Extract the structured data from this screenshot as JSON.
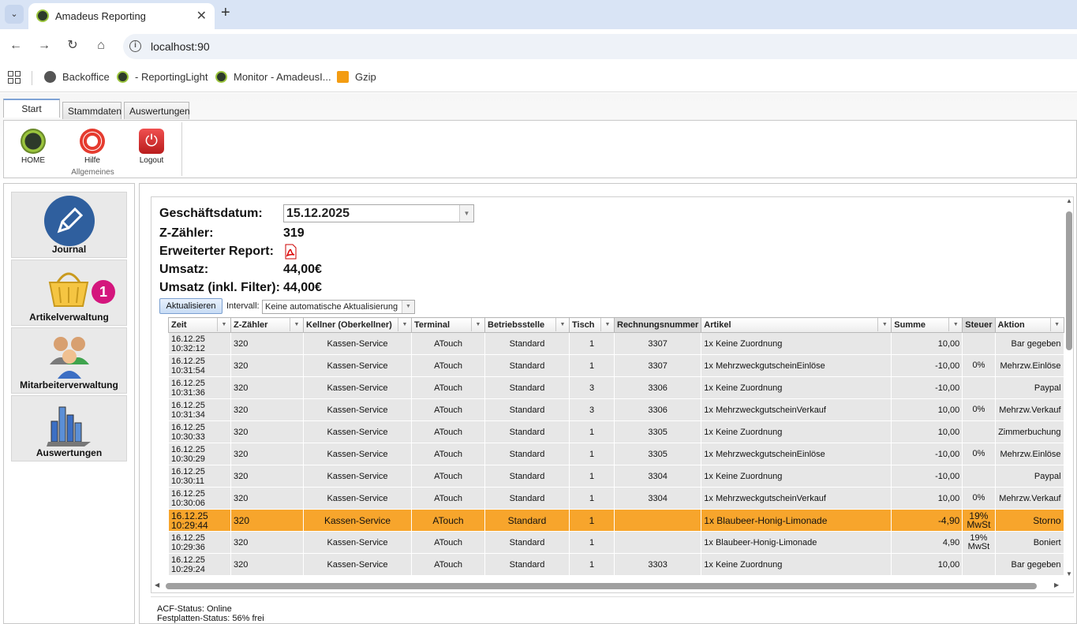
{
  "browser": {
    "tab_title": "Amadeus Reporting",
    "url": "localhost:90",
    "bookmarks": [
      "Backoffice",
      "- ReportingLight",
      "Monitor - AmadeusI...",
      "Gzip"
    ]
  },
  "ribbon": {
    "tabs": [
      "Start",
      "Stammdaten",
      "Auswertungen"
    ],
    "buttons": [
      "HOME",
      "Hilfe",
      "Logout"
    ],
    "group_label": "Allgemeines"
  },
  "nav": {
    "items": [
      "Journal",
      "Artikelverwaltung",
      "Mitarbeiterverwaltung",
      "Auswertungen"
    ],
    "badge": "1"
  },
  "report": {
    "labels": {
      "date": "Geschäftsdatum:",
      "z": "Z-Zähler:",
      "extended": "Erweiterter Report:",
      "umsatz": "Umsatz:",
      "umsatz_filter": "Umsatz (inkl. Filter):"
    },
    "date_value": "15.12.2025",
    "z_value": "319",
    "umsatz_value": "44,00€",
    "umsatz_filter_value": "44,00€",
    "refresh_label": "Aktualisieren",
    "intervall_label": "Intervall:",
    "intervall_value": "Keine automatische Aktualisierung"
  },
  "grid": {
    "columns": [
      "Zeit",
      "Z-Zähler",
      "Kellner (Oberkellner)",
      "Terminal",
      "Betriebsstelle",
      "Tisch",
      "Rechnungsnummer",
      "Artikel",
      "Summe",
      "Steuer",
      "Aktion"
    ],
    "rows": [
      {
        "d": "16.12.25",
        "t": "10:32:12",
        "z": "320",
        "k": "Kassen-Service",
        "term": "ATouch",
        "b": "Standard",
        "tisch": "1",
        "rn": "3307",
        "a": "1x Keine Zuordnung",
        "s": "10,00",
        "st": "",
        "ak": "Bar gegeben"
      },
      {
        "d": "16.12.25",
        "t": "10:31:54",
        "z": "320",
        "k": "Kassen-Service",
        "term": "ATouch",
        "b": "Standard",
        "tisch": "1",
        "rn": "3307",
        "a": "1x MehrzweckgutscheinEinlöse",
        "s": "-10,00",
        "st": "0%",
        "ak": "Mehrzw.Einlöse"
      },
      {
        "d": "16.12.25",
        "t": "10:31:36",
        "z": "320",
        "k": "Kassen-Service",
        "term": "ATouch",
        "b": "Standard",
        "tisch": "3",
        "rn": "3306",
        "a": "1x Keine Zuordnung",
        "s": "-10,00",
        "st": "",
        "ak": "Paypal"
      },
      {
        "d": "16.12.25",
        "t": "10:31:34",
        "z": "320",
        "k": "Kassen-Service",
        "term": "ATouch",
        "b": "Standard",
        "tisch": "3",
        "rn": "3306",
        "a": "1x MehrzweckgutscheinVerkauf",
        "s": "10,00",
        "st": "0%",
        "ak": "Mehrzw.Verkauf"
      },
      {
        "d": "16.12.25",
        "t": "10:30:33",
        "z": "320",
        "k": "Kassen-Service",
        "term": "ATouch",
        "b": "Standard",
        "tisch": "1",
        "rn": "3305",
        "a": "1x Keine Zuordnung",
        "s": "10,00",
        "st": "",
        "ak": "Zimmerbuchung"
      },
      {
        "d": "16.12.25",
        "t": "10:30:29",
        "z": "320",
        "k": "Kassen-Service",
        "term": "ATouch",
        "b": "Standard",
        "tisch": "1",
        "rn": "3305",
        "a": "1x MehrzweckgutscheinEinlöse",
        "s": "-10,00",
        "st": "0%",
        "ak": "Mehrzw.Einlöse"
      },
      {
        "d": "16.12.25",
        "t": "10:30:11",
        "z": "320",
        "k": "Kassen-Service",
        "term": "ATouch",
        "b": "Standard",
        "tisch": "1",
        "rn": "3304",
        "a": "1x Keine Zuordnung",
        "s": "-10,00",
        "st": "",
        "ak": "Paypal"
      },
      {
        "d": "16.12.25",
        "t": "10:30:06",
        "z": "320",
        "k": "Kassen-Service",
        "term": "ATouch",
        "b": "Standard",
        "tisch": "1",
        "rn": "3304",
        "a": "1x MehrzweckgutscheinVerkauf",
        "s": "10,00",
        "st": "0%",
        "ak": "Mehrzw.Verkauf"
      },
      {
        "d": "16.12.25",
        "t": "10:29:44",
        "z": "320",
        "k": "Kassen-Service",
        "term": "ATouch",
        "b": "Standard",
        "tisch": "1",
        "rn": "",
        "a": "1x Blaubeer-Honig-Limonade",
        "s": "-4,90",
        "st": "19% MwSt",
        "ak": "Storno",
        "highlight": true
      },
      {
        "d": "16.12.25",
        "t": "10:29:36",
        "z": "320",
        "k": "Kassen-Service",
        "term": "ATouch",
        "b": "Standard",
        "tisch": "1",
        "rn": "",
        "a": "1x Blaubeer-Honig-Limonade",
        "s": "4,90",
        "st": "19% MwSt",
        "ak": "Boniert"
      },
      {
        "d": "16.12.25",
        "t": "10:29:24",
        "z": "320",
        "k": "Kassen-Service",
        "term": "ATouch",
        "b": "Standard",
        "tisch": "1",
        "rn": "3303",
        "a": "1x Keine Zuordnung",
        "s": "10,00",
        "st": "",
        "ak": "Bar gegeben"
      }
    ]
  },
  "status": {
    "acf": "ACF-Status: Online",
    "disk": "Festplatten-Status: 56% frei"
  }
}
